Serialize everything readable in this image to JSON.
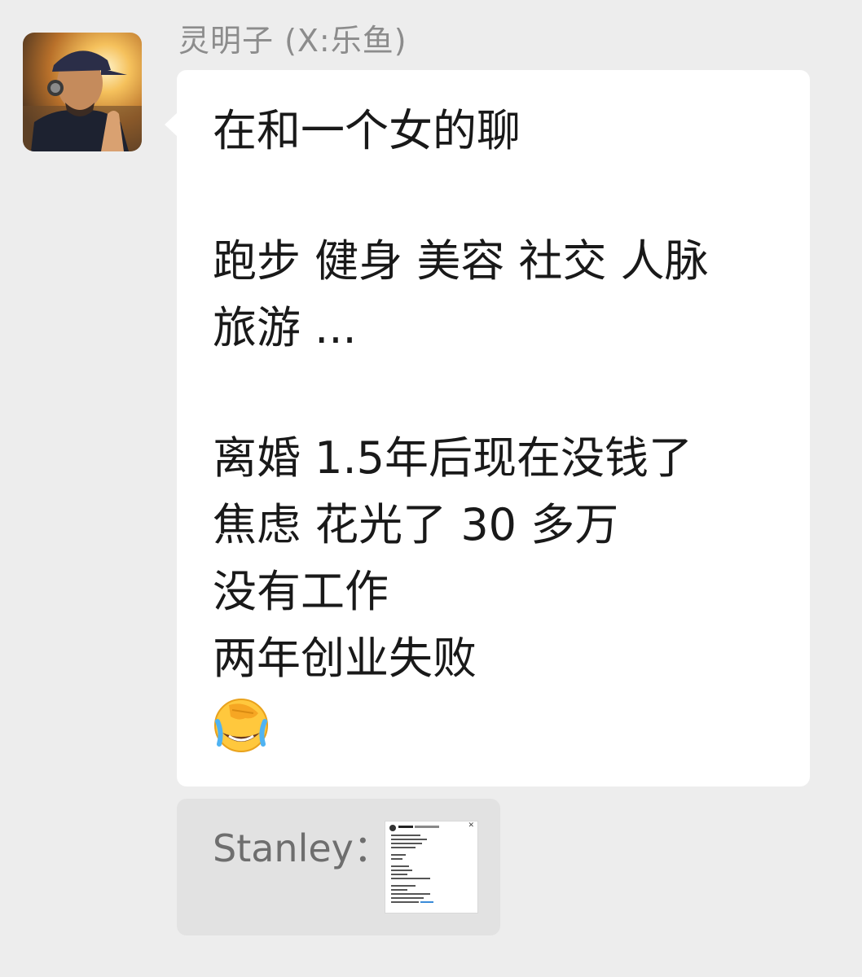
{
  "sender": {
    "name": "灵明子 (X:乐鱼)"
  },
  "message": {
    "lines_group1": [
      "在和一个女的聊"
    ],
    "lines_group2": [
      "跑步 健身 美容 社交 人脉",
      "旅游 ..."
    ],
    "lines_group3": [
      "离婚 1.5年后现在没钱了",
      "焦虑 花光了 30 多万",
      "没有工作",
      "两年创业失败"
    ],
    "emoji": "face-with-tears-of-joy-hand-icon"
  },
  "quote": {
    "sender": "Stanley：",
    "thumbnail": "tweet-screenshot-thumbnail"
  },
  "colors": {
    "background": "#ededed",
    "bubble": "#ffffff",
    "quote_bubble": "#e2e2e2",
    "sender_name": "#8c8c8c",
    "text": "#191919"
  }
}
